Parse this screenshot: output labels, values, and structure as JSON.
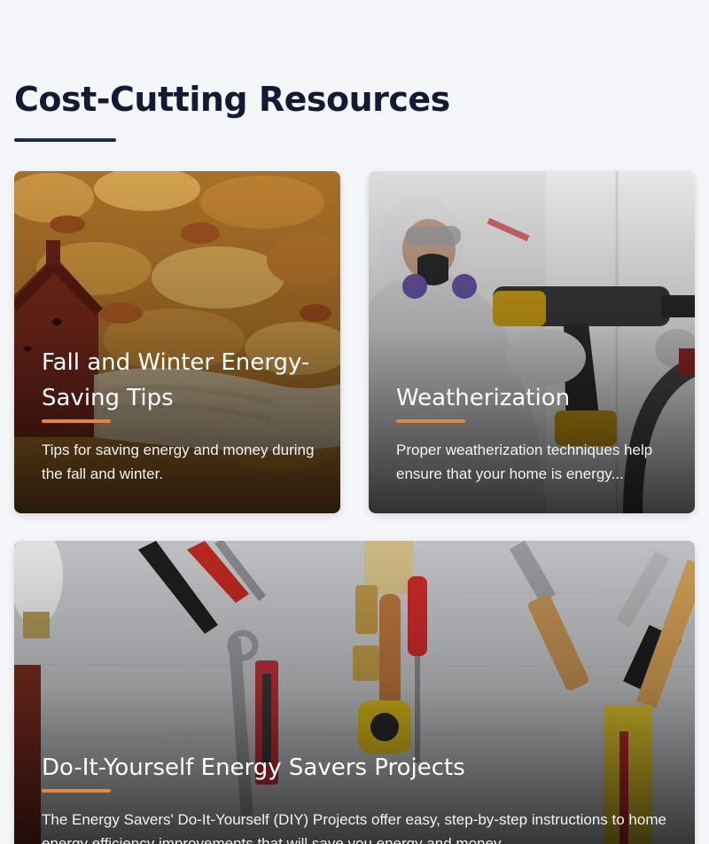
{
  "section": {
    "title": "Cost-Cutting Resources"
  },
  "cards": [
    {
      "title": "Fall and Winter Energy-Saving Tips",
      "description": "Tips for saving energy and money during the fall and winter.",
      "image": "autumn-leaves-house-photo"
    },
    {
      "title": "Weatherization",
      "description": "Proper weatherization techniques help ensure that your home is energy...",
      "image": "worker-with-drill-photo"
    },
    {
      "title": "Do-It-Yourself Energy Savers Projects",
      "description": "The Energy Savers' Do-It-Yourself (DIY) Projects offer easy, step-by-step instructions to home energy efficiency improvements that will save you energy and money.",
      "image": "tools-on-table-photo"
    }
  ],
  "colors": {
    "background": "#f5f6fa",
    "title": "#131a33",
    "underline": "#1b2a4e",
    "accent": "#e8853d"
  }
}
